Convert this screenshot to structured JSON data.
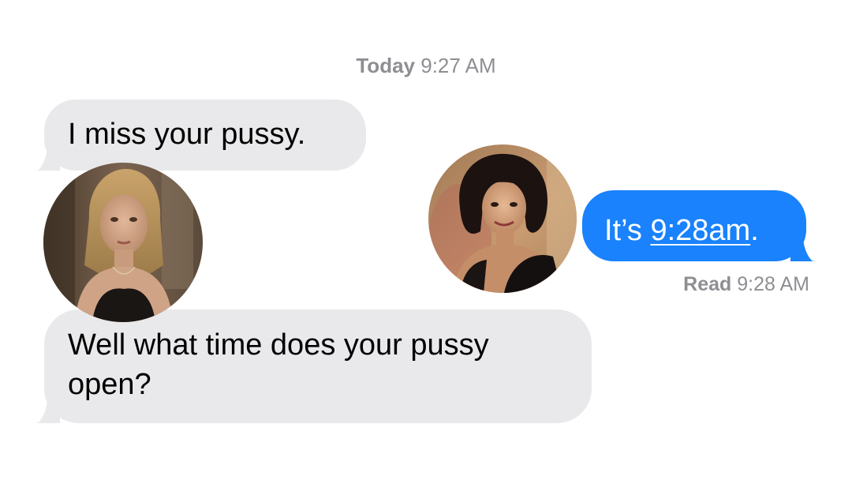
{
  "header": {
    "timestamp_day": "Today",
    "timestamp_time": "9:27 AM"
  },
  "messages": [
    {
      "direction": "incoming",
      "text": "I miss your pussy."
    },
    {
      "direction": "outgoing",
      "text_prefix": "It’s ",
      "link_text": "9:28am",
      "text_suffix": "."
    },
    {
      "direction": "incoming",
      "text": "Well what time does your pussy open?"
    }
  ],
  "receipt": {
    "label": "Read",
    "time": "9:28 AM"
  },
  "avatars": [
    {
      "name": "contact-photo-blonde-woman"
    },
    {
      "name": "contact-photo-dark-haired-woman"
    }
  ],
  "colors": {
    "incoming_bubble": "#e9e9eb",
    "outgoing_bubble": "#1982fc",
    "meta_text": "#8e8e93"
  }
}
